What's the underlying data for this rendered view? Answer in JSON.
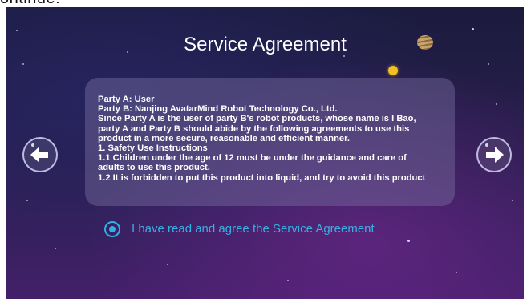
{
  "header": {
    "cutoff_text": "ontinue:"
  },
  "screen": {
    "title": "Service Agreement",
    "agreement_lines": [
      "Party A: User",
      "Party B: Nanjing AvatarMind Robot Technology Co., Ltd.",
      "Since Party A is the user of party B's robot products, whose name is I Bao,",
      "party A and Party B should abide by the following agreements to use this",
      "product in a more secure, reasonable and efficient manner.",
      "1. Safety Use Instructions",
      "1.1 Children under the age of 12 must be under the guidance and care of",
      "adults to use this product.",
      "1.2 It is forbidden to put this product into liquid, and try to avoid this product"
    ],
    "agree_checkbox": {
      "label": "I have read and agree the Service Agreement",
      "checked": true
    },
    "nav": {
      "prev_icon": "arrow-left-icon",
      "next_icon": "arrow-right-icon"
    }
  },
  "colors": {
    "accent": "#2fb0e6",
    "text": "#ffffff",
    "moon": "#f2c021"
  }
}
